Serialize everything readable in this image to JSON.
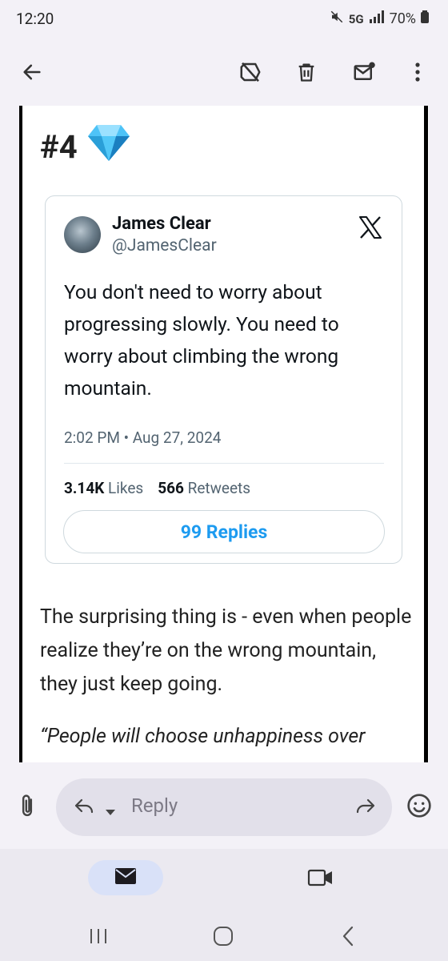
{
  "status": {
    "time": "12:20",
    "network": "5G",
    "battery": "70%"
  },
  "email": {
    "heading": "#4",
    "heading_emoji": "💎",
    "tweet": {
      "author_name": "James Clear",
      "author_handle": "@JamesClear",
      "text": "You don't need to worry about progressing slowly. You need to worry about climbing the wrong mountain.",
      "date": "2:02 PM • Aug 27, 2024",
      "likes_count": "3.14K",
      "likes_label": "Likes",
      "retweets_count": "566",
      "retweets_label": "Retweets",
      "replies_label": "99 Replies"
    },
    "paragraph": "The surprising thing is - even when people realize they’re on the wrong mountain, they just keep going.",
    "quote_partial": "“People will choose unhappiness over"
  },
  "reply": {
    "placeholder": "Reply"
  },
  "icons": {
    "back": "arrow-left-icon",
    "label_off": "label-off-icon",
    "delete": "trash-icon",
    "mark_unread": "mail-unread-icon",
    "more": "more-vertical-icon",
    "attach": "paperclip-icon",
    "reply": "reply-icon",
    "forward": "forward-icon",
    "emoji": "emoji-icon",
    "mail_tab": "mail-icon",
    "meet_tab": "video-icon"
  }
}
